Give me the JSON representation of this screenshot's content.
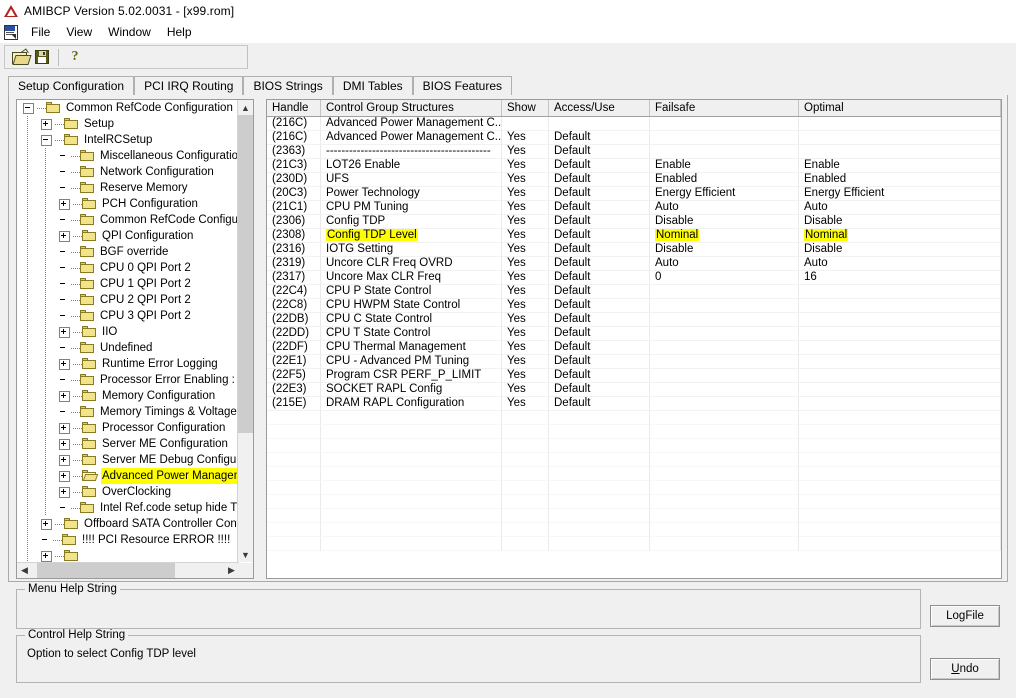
{
  "window": {
    "title": "AMIBCP Version 5.02.0031 - [x99.rom]",
    "logo_icon": "ami-logo-icon"
  },
  "menubar": {
    "rom_icon": "rom-document-icon",
    "items": [
      "File",
      "View",
      "Window",
      "Help"
    ]
  },
  "toolbar": {
    "buttons": [
      {
        "name": "open-icon",
        "label": "Open"
      },
      {
        "name": "save-icon",
        "label": "Save"
      },
      {
        "name": "help-icon",
        "label": "Help"
      }
    ]
  },
  "tabs": [
    {
      "label": "Setup Configuration",
      "active": true
    },
    {
      "label": "PCI IRQ Routing",
      "active": false
    },
    {
      "label": "BIOS Strings",
      "active": false
    },
    {
      "label": "DMI Tables",
      "active": false
    },
    {
      "label": "BIOS Features",
      "active": false
    }
  ],
  "tree": {
    "nodes": [
      {
        "label": "Common RefCode Configuration",
        "depth": 0,
        "toggle": "minus",
        "folder": "closed",
        "highlight": false
      },
      {
        "label": "Setup",
        "depth": 1,
        "toggle": "plus",
        "folder": "closed",
        "highlight": false
      },
      {
        "label": "IntelRCSetup",
        "depth": 1,
        "toggle": "minus",
        "folder": "closed",
        "highlight": false
      },
      {
        "label": "Miscellaneous Configuration",
        "depth": 2,
        "toggle": "none",
        "folder": "closed",
        "highlight": false
      },
      {
        "label": "Network Configuration",
        "depth": 2,
        "toggle": "none",
        "folder": "closed",
        "highlight": false
      },
      {
        "label": "Reserve Memory",
        "depth": 2,
        "toggle": "none",
        "folder": "closed",
        "highlight": false
      },
      {
        "label": "PCH Configuration",
        "depth": 2,
        "toggle": "plus",
        "folder": "closed",
        "highlight": false
      },
      {
        "label": "Common RefCode Configurati",
        "depth": 2,
        "toggle": "none",
        "folder": "closed",
        "highlight": false
      },
      {
        "label": "QPI Configuration",
        "depth": 2,
        "toggle": "plus",
        "folder": "closed",
        "highlight": false
      },
      {
        "label": "BGF override",
        "depth": 2,
        "toggle": "none",
        "folder": "closed",
        "highlight": false
      },
      {
        "label": "CPU 0 QPI Port 2",
        "depth": 2,
        "toggle": "none",
        "folder": "closed",
        "highlight": false
      },
      {
        "label": "CPU 1 QPI Port 2",
        "depth": 2,
        "toggle": "none",
        "folder": "closed",
        "highlight": false
      },
      {
        "label": "CPU 2 QPI Port 2",
        "depth": 2,
        "toggle": "none",
        "folder": "closed",
        "highlight": false
      },
      {
        "label": "CPU 3 QPI Port 2",
        "depth": 2,
        "toggle": "none",
        "folder": "closed",
        "highlight": false
      },
      {
        "label": "IIO",
        "depth": 2,
        "toggle": "plus",
        "folder": "closed",
        "highlight": false
      },
      {
        "label": "Undefined",
        "depth": 2,
        "toggle": "none",
        "folder": "closed",
        "highlight": false
      },
      {
        "label": "Runtime Error Logging",
        "depth": 2,
        "toggle": "plus",
        "folder": "closed",
        "highlight": false
      },
      {
        "label": "Processor Error Enabling :",
        "depth": 2,
        "toggle": "none",
        "folder": "closed",
        "highlight": false
      },
      {
        "label": "Memory Configuration",
        "depth": 2,
        "toggle": "plus",
        "folder": "closed",
        "highlight": false
      },
      {
        "label": "Memory Timings & Voltage Ov",
        "depth": 2,
        "toggle": "none",
        "folder": "closed",
        "highlight": false
      },
      {
        "label": "Processor Configuration",
        "depth": 2,
        "toggle": "plus",
        "folder": "closed",
        "highlight": false
      },
      {
        "label": "Server ME Configuration",
        "depth": 2,
        "toggle": "plus",
        "folder": "closed",
        "highlight": false
      },
      {
        "label": "Server ME Debug Configurati",
        "depth": 2,
        "toggle": "plus",
        "folder": "closed",
        "highlight": false
      },
      {
        "label": "Advanced Power Manageme",
        "depth": 2,
        "toggle": "plus",
        "folder": "open",
        "highlight": true
      },
      {
        "label": "OverClocking",
        "depth": 2,
        "toggle": "plus",
        "folder": "closed",
        "highlight": false
      },
      {
        "label": "Intel Ref.code setup hide Title",
        "depth": 2,
        "toggle": "none",
        "folder": "closed",
        "highlight": false
      },
      {
        "label": "Offboard SATA Controller Configu",
        "depth": 1,
        "toggle": "plus",
        "folder": "closed",
        "highlight": false
      },
      {
        "label": "!!!! PCI Resource ERROR !!!!",
        "depth": 1,
        "toggle": "none",
        "folder": "closed",
        "highlight": false
      },
      {
        "label": "",
        "depth": 1,
        "toggle": "plus",
        "folder": "closed",
        "highlight": false
      }
    ],
    "vscroll": {
      "up_icon": "chevron-up-icon",
      "down_icon": "chevron-down-icon"
    },
    "hscroll": {
      "left_icon": "chevron-left-icon",
      "right_icon": "chevron-right-icon"
    }
  },
  "list": {
    "columns": [
      "Handle",
      "Control Group Structures",
      "Show",
      "Access/Use",
      "Failsafe",
      "Optimal"
    ],
    "rows": [
      {
        "handle": "(216C)",
        "name": "Advanced Power Management C...",
        "show": "",
        "access": "",
        "failsafe": "",
        "optimal": "",
        "hl_name": false,
        "hl_failsafe": false,
        "hl_optimal": false
      },
      {
        "handle": "(216C)",
        "name": "Advanced Power Management C...",
        "show": "Yes",
        "access": "Default",
        "failsafe": "",
        "optimal": "",
        "hl_name": false,
        "hl_failsafe": false,
        "hl_optimal": false
      },
      {
        "handle": "(2363)",
        "name": "-------------------------------------------",
        "show": "Yes",
        "access": "Default",
        "failsafe": "",
        "optimal": "",
        "hl_name": false,
        "hl_failsafe": false,
        "hl_optimal": false
      },
      {
        "handle": "(21C3)",
        "name": "LOT26 Enable",
        "show": "Yes",
        "access": "Default",
        "failsafe": "Enable",
        "optimal": "Enable",
        "hl_name": false,
        "hl_failsafe": false,
        "hl_optimal": false
      },
      {
        "handle": "(230D)",
        "name": "UFS",
        "show": "Yes",
        "access": "Default",
        "failsafe": "Enabled",
        "optimal": "Enabled",
        "hl_name": false,
        "hl_failsafe": false,
        "hl_optimal": false
      },
      {
        "handle": "(20C3)",
        "name": "Power Technology",
        "show": "Yes",
        "access": "Default",
        "failsafe": "Energy Efficient",
        "optimal": "Energy Efficient",
        "hl_name": false,
        "hl_failsafe": false,
        "hl_optimal": false
      },
      {
        "handle": "(21C1)",
        "name": "CPU PM Tuning",
        "show": "Yes",
        "access": "Default",
        "failsafe": "Auto",
        "optimal": "Auto",
        "hl_name": false,
        "hl_failsafe": false,
        "hl_optimal": false
      },
      {
        "handle": "(2306)",
        "name": "Config TDP",
        "show": "Yes",
        "access": "Default",
        "failsafe": "Disable",
        "optimal": "Disable",
        "hl_name": false,
        "hl_failsafe": false,
        "hl_optimal": false
      },
      {
        "handle": "(2308)",
        "name": "Config TDP Level",
        "show": "Yes",
        "access": "Default",
        "failsafe": "Nominal",
        "optimal": "Nominal",
        "hl_name": true,
        "hl_failsafe": true,
        "hl_optimal": true
      },
      {
        "handle": "(2316)",
        "name": "IOTG Setting",
        "show": "Yes",
        "access": "Default",
        "failsafe": "Disable",
        "optimal": "Disable",
        "hl_name": false,
        "hl_failsafe": false,
        "hl_optimal": false
      },
      {
        "handle": "(2319)",
        "name": "Uncore CLR Freq OVRD",
        "show": "Yes",
        "access": "Default",
        "failsafe": "Auto",
        "optimal": "Auto",
        "hl_name": false,
        "hl_failsafe": false,
        "hl_optimal": false
      },
      {
        "handle": "(2317)",
        "name": "Uncore Max CLR Freq",
        "show": "Yes",
        "access": "Default",
        "failsafe": "0",
        "optimal": "16",
        "hl_name": false,
        "hl_failsafe": false,
        "hl_optimal": false
      },
      {
        "handle": "(22C4)",
        "name": "CPU P State Control",
        "show": "Yes",
        "access": "Default",
        "failsafe": "",
        "optimal": "",
        "hl_name": false,
        "hl_failsafe": false,
        "hl_optimal": false
      },
      {
        "handle": "(22C8)",
        "name": "CPU HWPM State Control",
        "show": "Yes",
        "access": "Default",
        "failsafe": "",
        "optimal": "",
        "hl_name": false,
        "hl_failsafe": false,
        "hl_optimal": false
      },
      {
        "handle": "(22DB)",
        "name": "CPU C State Control",
        "show": "Yes",
        "access": "Default",
        "failsafe": "",
        "optimal": "",
        "hl_name": false,
        "hl_failsafe": false,
        "hl_optimal": false
      },
      {
        "handle": "(22DD)",
        "name": "CPU T State Control",
        "show": "Yes",
        "access": "Default",
        "failsafe": "",
        "optimal": "",
        "hl_name": false,
        "hl_failsafe": false,
        "hl_optimal": false
      },
      {
        "handle": "(22DF)",
        "name": "CPU Thermal Management",
        "show": "Yes",
        "access": "Default",
        "failsafe": "",
        "optimal": "",
        "hl_name": false,
        "hl_failsafe": false,
        "hl_optimal": false
      },
      {
        "handle": "(22E1)",
        "name": "CPU - Advanced PM Tuning",
        "show": "Yes",
        "access": "Default",
        "failsafe": "",
        "optimal": "",
        "hl_name": false,
        "hl_failsafe": false,
        "hl_optimal": false
      },
      {
        "handle": "(22F5)",
        "name": "Program CSR PERF_P_LIMIT",
        "show": "Yes",
        "access": "Default",
        "failsafe": "",
        "optimal": "",
        "hl_name": false,
        "hl_failsafe": false,
        "hl_optimal": false
      },
      {
        "handle": "(22E3)",
        "name": "SOCKET RAPL Config",
        "show": "Yes",
        "access": "Default",
        "failsafe": "",
        "optimal": "",
        "hl_name": false,
        "hl_failsafe": false,
        "hl_optimal": false
      },
      {
        "handle": "(215E)",
        "name": "DRAM RAPL Configuration",
        "show": "Yes",
        "access": "Default",
        "failsafe": "",
        "optimal": "",
        "hl_name": false,
        "hl_failsafe": false,
        "hl_optimal": false
      }
    ]
  },
  "menu_help": {
    "title": "Menu Help String",
    "text": ""
  },
  "control_help": {
    "title": "Control Help String",
    "text": "Option to select Config TDP level"
  },
  "buttons": {
    "logfile": "LogFile",
    "undo_prefix": "U",
    "undo_rest": "ndo"
  },
  "colors": {
    "highlight": "#ffff00",
    "window_bg": "#f0f0f0",
    "panel_bg": "#ffffff"
  }
}
